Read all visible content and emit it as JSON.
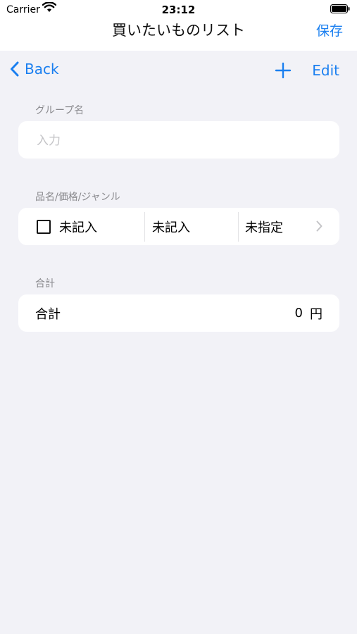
{
  "status_bar": {
    "carrier": "Carrier",
    "time": "23:12"
  },
  "nav": {
    "title": "買いたいものリスト",
    "save_label": "保存"
  },
  "toolbar": {
    "back_label": "Back",
    "edit_label": "Edit"
  },
  "group": {
    "section_label": "グループ名",
    "placeholder": "入力",
    "value": ""
  },
  "items": {
    "section_label": "品名/価格/ジャンル",
    "rows": [
      {
        "name": "未記入",
        "price": "未記入",
        "genre": "未指定",
        "checked": false
      }
    ]
  },
  "total": {
    "section_label": "合計",
    "label": "合計",
    "amount": "0",
    "unit": "円"
  },
  "colors": {
    "accent": "#1a7ff0",
    "background": "#f2f2f7",
    "card": "#ffffff"
  }
}
